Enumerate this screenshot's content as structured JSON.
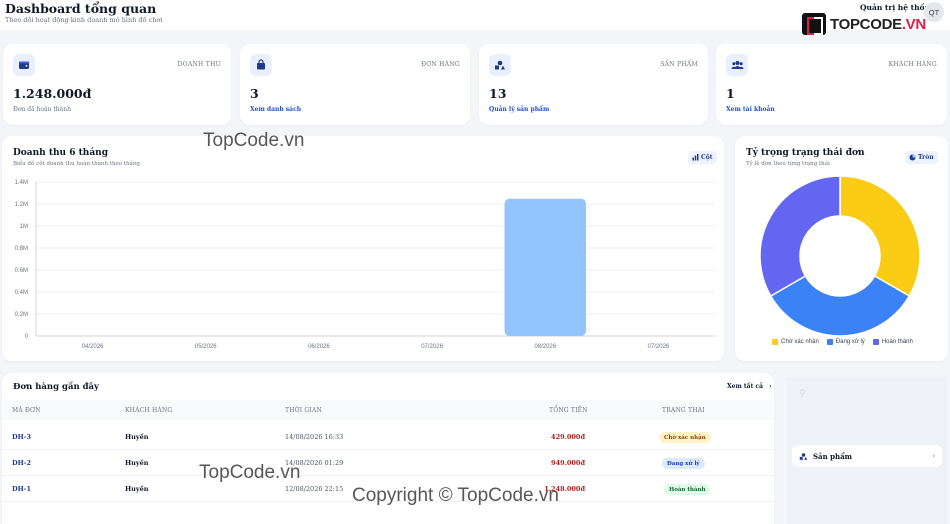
{
  "header": {
    "title": "Dashboard tổng quan",
    "subtitle": "Theo dõi hoạt động kinh doanh mô hình đồ chơi",
    "user_name": "Quản trị hệ thống",
    "avatar_initials": "QT"
  },
  "logo": {
    "brand": "TOPCODE",
    "tld": ".VN"
  },
  "stats": [
    {
      "label": "DOANH THU",
      "value": "1.248.000đ",
      "sub": "Đơn đã hoàn thành",
      "icon": "wallet-icon"
    },
    {
      "label": "ĐƠN HÀNG",
      "value": "3",
      "link": "Xem danh sách",
      "icon": "bag-icon"
    },
    {
      "label": "SẢN PHẨM",
      "value": "13",
      "link": "Quản lý sản phẩm",
      "icon": "shapes-icon"
    },
    {
      "label": "KHÁCH HÀNG",
      "value": "1",
      "link": "Xem tài khoản",
      "icon": "users-icon"
    }
  ],
  "revenue_chart": {
    "title": "Doanh thu 6 tháng",
    "subtitle": "Biểu đồ cột doanh thu hoàn thành theo tháng",
    "toggle_label": "Cột"
  },
  "status_chart": {
    "title": "Tỷ trọng trạng thái đơn",
    "subtitle": "Tỷ lệ đơn theo từng trạng thái",
    "toggle_label": "Tròn"
  },
  "chart_data": [
    {
      "type": "bar",
      "categories": [
        "04/2026",
        "05/2026",
        "06/2026",
        "07/2026",
        "08/2026",
        "07/2026"
      ],
      "values": [
        0,
        0,
        0,
        0,
        1248000,
        0
      ],
      "yticks": [
        "0",
        "0.2M",
        "0.4M",
        "0.6M",
        "0.8M",
        "1M",
        "1.2M",
        "1.4M"
      ],
      "ylim": [
        0,
        1400000
      ],
      "grid": true,
      "color": "#93c5fd"
    },
    {
      "type": "pie",
      "donut": true,
      "labels": [
        "Chờ xác nhận",
        "Đang xử lý",
        "Hoàn thành"
      ],
      "values": [
        1,
        1,
        1
      ],
      "colors": [
        "#facc15",
        "#3b82f6",
        "#6366f1"
      ],
      "legend": "bottom"
    }
  ],
  "orders": {
    "title": "Đơn hàng gần đây",
    "view_all": "Xem tất cả",
    "columns": [
      "MÃ ĐƠN",
      "KHÁCH HÀNG",
      "THỜI GIAN",
      "TỔNG TIỀN",
      "TRẠNG THÁI"
    ],
    "rows": [
      {
        "code": "DH-3",
        "customer": "Huyền",
        "time": "14/08/2026 16:33",
        "total": "429.000đ",
        "status": "Chờ xác nhận"
      },
      {
        "code": "DH-2",
        "customer": "Huyền",
        "time": "14/08/2026 01:29",
        "total": "949.000đ",
        "status": "Đang xử lý"
      },
      {
        "code": "DH-1",
        "customer": "Huyền",
        "time": "12/08/2026 22:15",
        "total": "1.248.000đ",
        "status": "Hoàn thành"
      }
    ]
  },
  "side_panel": {
    "item_label": "Sản phẩm"
  },
  "watermarks": [
    "TopCode.vn",
    "TopCode.vn",
    "Copyright © TopCode.vn"
  ],
  "status_colors": {
    "Chờ xác nhận": {
      "bg": "#fef3c7",
      "fg": "#92400e"
    },
    "Đang xử lý": {
      "bg": "#dbeafe",
      "fg": "#1e40af"
    },
    "Hoàn thành": {
      "bg": "#dcfce7",
      "fg": "#166534"
    }
  }
}
